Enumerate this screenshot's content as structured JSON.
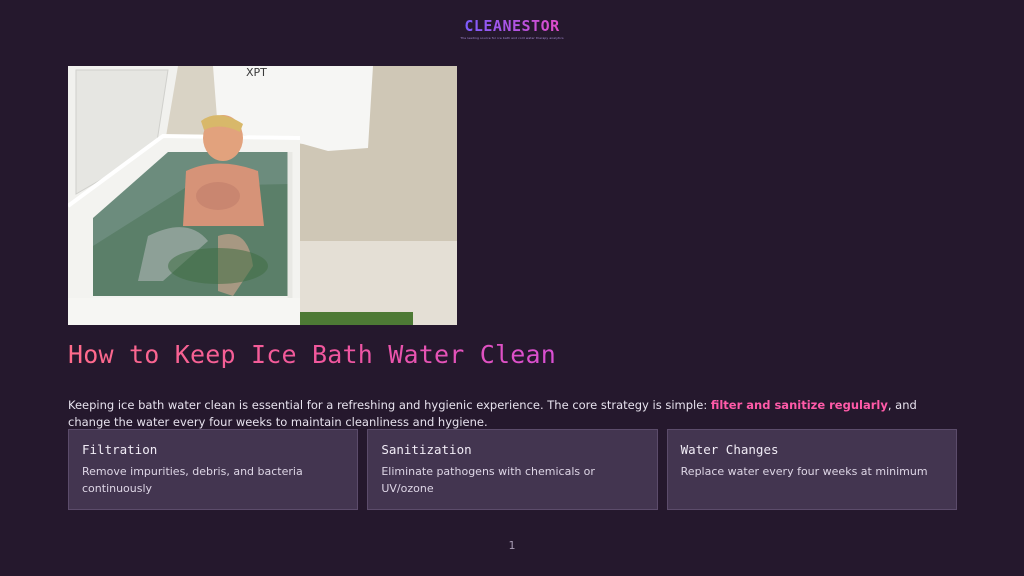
{
  "header": {
    "logo_text": "CLEANESTOR",
    "tagline": "The leading source for ice bath and cold water therapy analytics"
  },
  "hero_image": {
    "alt": "Man sitting in a chest freezer ice bath",
    "shirt_text": "XPT"
  },
  "title": "How to Keep Ice Bath Water Clean",
  "intro": {
    "before": "Keeping ice bath water clean is essential for a refreshing and hygienic experience. The core strategy is simple: ",
    "highlight": "filter and sanitize regularly",
    "after": ", and change the water every four weeks to maintain cleanliness and hygiene."
  },
  "cards": [
    {
      "title": "Filtration",
      "description": "Remove impurities, debris, and bacteria continuously"
    },
    {
      "title": "Sanitization",
      "description": "Eliminate pathogens with chemicals or UV/ozone"
    },
    {
      "title": "Water Changes",
      "description": "Replace water every four weeks at minimum"
    }
  ],
  "page_number": "1",
  "colors": {
    "background": "#25182d",
    "card_background": "#433550",
    "title_gradient_start": "#ff6b8b",
    "title_gradient_end": "#d94fd3",
    "highlight": "#ff5aa8"
  }
}
